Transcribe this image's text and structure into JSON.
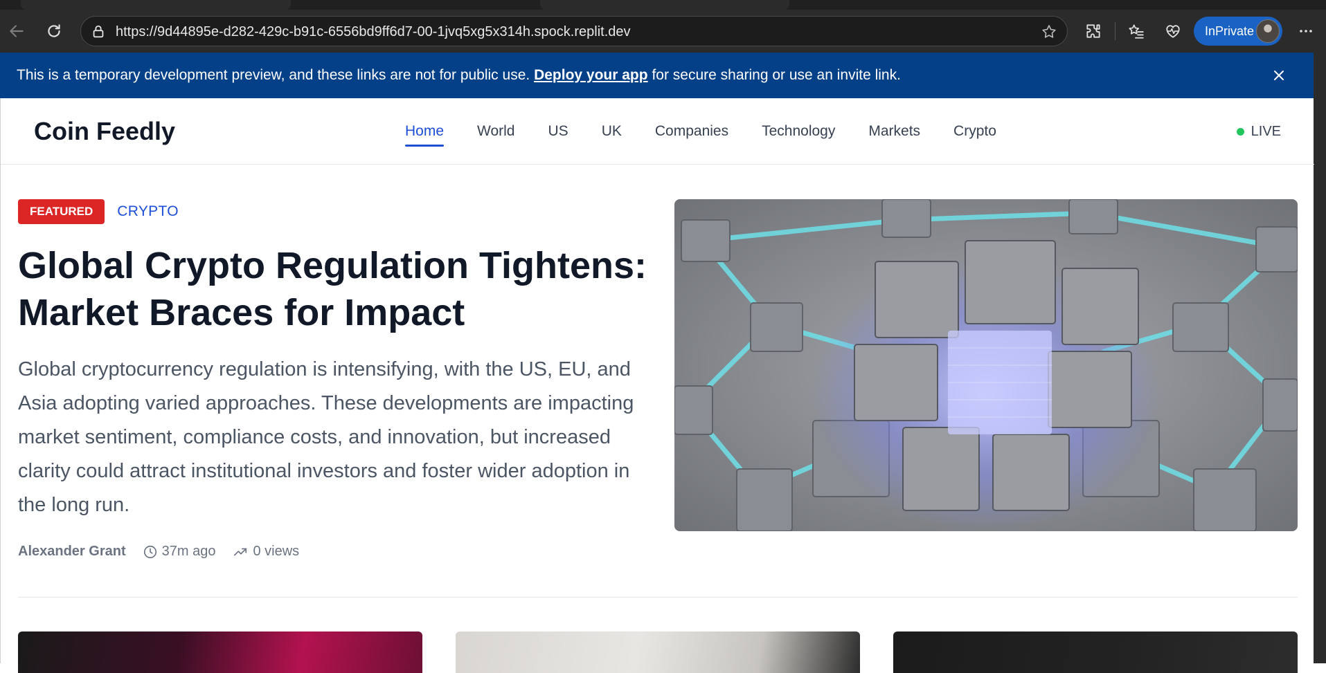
{
  "browser": {
    "url": "https://9d44895e-d282-429c-b91c-6556bd9ff6d7-00-1jvq5xg5x314h.spock.replit.dev",
    "profile_label": "InPrivate",
    "icons": [
      "back-icon",
      "refresh-icon",
      "lock-icon",
      "favorite-star-icon",
      "extensions-icon",
      "favorites-icon",
      "browser-essentials-icon",
      "more-menu-icon"
    ]
  },
  "banner": {
    "text_before": "This is a temporary development preview, and these links are not for public use.",
    "link": "Deploy your app",
    "text_after": "for secure sharing or use an invite link."
  },
  "site": {
    "logo": "Coin Feedly",
    "nav": [
      {
        "label": "Home",
        "active": true
      },
      {
        "label": "World",
        "active": false
      },
      {
        "label": "US",
        "active": false
      },
      {
        "label": "UK",
        "active": false
      },
      {
        "label": "Companies",
        "active": false
      },
      {
        "label": "Technology",
        "active": false
      },
      {
        "label": "Markets",
        "active": false
      },
      {
        "label": "Crypto",
        "active": false
      }
    ],
    "live_label": "LIVE",
    "live_color": "#22c55e",
    "accent_color": "#1d4ed8"
  },
  "featured": {
    "badge": "FEATURED",
    "badge_color": "#dc2626",
    "category": "CRYPTO",
    "headline": "Global Crypto Regulation Tightens: Market Braces for Impact",
    "summary": "Global cryptocurrency regulation is intensifying, with the US, EU, and Asia adopting varied approaches. These developments are impacting market sentiment, compliance costs, and innovation, but increased clarity could attract institutional investors and foster wider adoption in the long run.",
    "author": "Alexander Grant",
    "time": "37m ago",
    "views": "0 views"
  }
}
